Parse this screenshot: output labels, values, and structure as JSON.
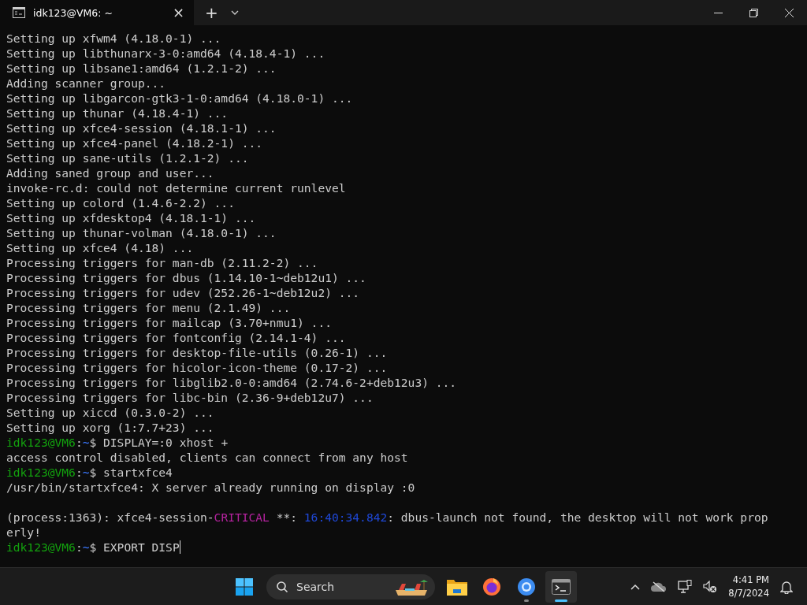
{
  "window": {
    "tab_title": "idk123@VM6: ~",
    "tab_close": "×",
    "new_tab": "+"
  },
  "terminal": {
    "lines": [
      {
        "kind": "text",
        "segments": [
          {
            "kind": "plain",
            "text": "Setting up xfwm4 (4.18.0-1) ..."
          }
        ]
      },
      {
        "kind": "text",
        "segments": [
          {
            "kind": "plain",
            "text": "Setting up libthunarx-3-0:amd64 (4.18.4-1) ..."
          }
        ]
      },
      {
        "kind": "text",
        "segments": [
          {
            "kind": "plain",
            "text": "Setting up libsane1:amd64 (1.2.1-2) ..."
          }
        ]
      },
      {
        "kind": "text",
        "segments": [
          {
            "kind": "plain",
            "text": "Adding scanner group..."
          }
        ]
      },
      {
        "kind": "text",
        "segments": [
          {
            "kind": "plain",
            "text": "Setting up libgarcon-gtk3-1-0:amd64 (4.18.0-1) ..."
          }
        ]
      },
      {
        "kind": "text",
        "segments": [
          {
            "kind": "plain",
            "text": "Setting up thunar (4.18.4-1) ..."
          }
        ]
      },
      {
        "kind": "text",
        "segments": [
          {
            "kind": "plain",
            "text": "Setting up xfce4-session (4.18.1-1) ..."
          }
        ]
      },
      {
        "kind": "text",
        "segments": [
          {
            "kind": "plain",
            "text": "Setting up xfce4-panel (4.18.2-1) ..."
          }
        ]
      },
      {
        "kind": "text",
        "segments": [
          {
            "kind": "plain",
            "text": "Setting up sane-utils (1.2.1-2) ..."
          }
        ]
      },
      {
        "kind": "text",
        "segments": [
          {
            "kind": "plain",
            "text": "Adding saned group and user..."
          }
        ]
      },
      {
        "kind": "text",
        "segments": [
          {
            "kind": "plain",
            "text": "invoke-rc.d: could not determine current runlevel"
          }
        ]
      },
      {
        "kind": "text",
        "segments": [
          {
            "kind": "plain",
            "text": "Setting up colord (1.4.6-2.2) ..."
          }
        ]
      },
      {
        "kind": "text",
        "segments": [
          {
            "kind": "plain",
            "text": "Setting up xfdesktop4 (4.18.1-1) ..."
          }
        ]
      },
      {
        "kind": "text",
        "segments": [
          {
            "kind": "plain",
            "text": "Setting up thunar-volman (4.18.0-1) ..."
          }
        ]
      },
      {
        "kind": "text",
        "segments": [
          {
            "kind": "plain",
            "text": "Setting up xfce4 (4.18) ..."
          }
        ]
      },
      {
        "kind": "text",
        "segments": [
          {
            "kind": "plain",
            "text": "Processing triggers for man-db (2.11.2-2) ..."
          }
        ]
      },
      {
        "kind": "text",
        "segments": [
          {
            "kind": "plain",
            "text": "Processing triggers for dbus (1.14.10-1~deb12u1) ..."
          }
        ]
      },
      {
        "kind": "text",
        "segments": [
          {
            "kind": "plain",
            "text": "Processing triggers for udev (252.26-1~deb12u2) ..."
          }
        ]
      },
      {
        "kind": "text",
        "segments": [
          {
            "kind": "plain",
            "text": "Processing triggers for menu (2.1.49) ..."
          }
        ]
      },
      {
        "kind": "text",
        "segments": [
          {
            "kind": "plain",
            "text": "Processing triggers for mailcap (3.70+nmu1) ..."
          }
        ]
      },
      {
        "kind": "text",
        "segments": [
          {
            "kind": "plain",
            "text": "Processing triggers for fontconfig (2.14.1-4) ..."
          }
        ]
      },
      {
        "kind": "text",
        "segments": [
          {
            "kind": "plain",
            "text": "Processing triggers for desktop-file-utils (0.26-1) ..."
          }
        ]
      },
      {
        "kind": "text",
        "segments": [
          {
            "kind": "plain",
            "text": "Processing triggers for hicolor-icon-theme (0.17-2) ..."
          }
        ]
      },
      {
        "kind": "text",
        "segments": [
          {
            "kind": "plain",
            "text": "Processing triggers for libglib2.0-0:amd64 (2.74.6-2+deb12u3) ..."
          }
        ]
      },
      {
        "kind": "text",
        "segments": [
          {
            "kind": "plain",
            "text": "Processing triggers for libc-bin (2.36-9+deb12u7) ..."
          }
        ]
      },
      {
        "kind": "text",
        "segments": [
          {
            "kind": "plain",
            "text": "Setting up xiccd (0.3.0-2) ..."
          }
        ]
      },
      {
        "kind": "text",
        "segments": [
          {
            "kind": "plain",
            "text": "Setting up xorg (1:7.7+23) ..."
          }
        ]
      },
      {
        "kind": "text",
        "segments": [
          {
            "kind": "user",
            "text": "idk123@VM6"
          },
          {
            "kind": "plain",
            "text": ":"
          },
          {
            "kind": "path",
            "text": "~"
          },
          {
            "kind": "plain",
            "text": "$ DISPLAY=:0 xhost +"
          }
        ]
      },
      {
        "kind": "text",
        "segments": [
          {
            "kind": "plain",
            "text": "access control disabled, clients can connect from any host"
          }
        ]
      },
      {
        "kind": "text",
        "segments": [
          {
            "kind": "user",
            "text": "idk123@VM6"
          },
          {
            "kind": "plain",
            "text": ":"
          },
          {
            "kind": "path",
            "text": "~"
          },
          {
            "kind": "plain",
            "text": "$ startxfce4"
          }
        ]
      },
      {
        "kind": "text",
        "segments": [
          {
            "kind": "plain",
            "text": "/usr/bin/startxfce4: X server already running on display :0"
          }
        ]
      },
      {
        "kind": "blank"
      },
      {
        "kind": "text",
        "segments": [
          {
            "kind": "plain",
            "text": "(process:1363): xfce4-session-"
          },
          {
            "kind": "critical",
            "text": "CRITICAL"
          },
          {
            "kind": "plain",
            "text": " **: "
          },
          {
            "kind": "timestamp",
            "text": "16:40:34.842"
          },
          {
            "kind": "plain",
            "text": ": dbus-launch not found, the desktop will not work prop"
          }
        ]
      },
      {
        "kind": "text",
        "segments": [
          {
            "kind": "plain",
            "text": "erly!"
          }
        ]
      },
      {
        "kind": "text",
        "cursor": true,
        "segments": [
          {
            "kind": "user",
            "text": "idk123@VM6"
          },
          {
            "kind": "plain",
            "text": ":"
          },
          {
            "kind": "path",
            "text": "~"
          },
          {
            "kind": "plain",
            "text": "$ EXPORT DISP"
          }
        ]
      }
    ]
  },
  "taskbar": {
    "search": {
      "placeholder": "Search"
    },
    "apps": [
      {
        "kind": "start",
        "running": false,
        "selected": false
      },
      {
        "kind": "folder",
        "running": false,
        "selected": false
      },
      {
        "kind": "firefox",
        "running": false,
        "selected": false
      },
      {
        "kind": "globe",
        "running": true,
        "selected": false
      },
      {
        "kind": "terminal",
        "running": true,
        "selected": true
      }
    ],
    "clock": {
      "time": "4:41 PM",
      "date": "8/7/2024"
    }
  }
}
